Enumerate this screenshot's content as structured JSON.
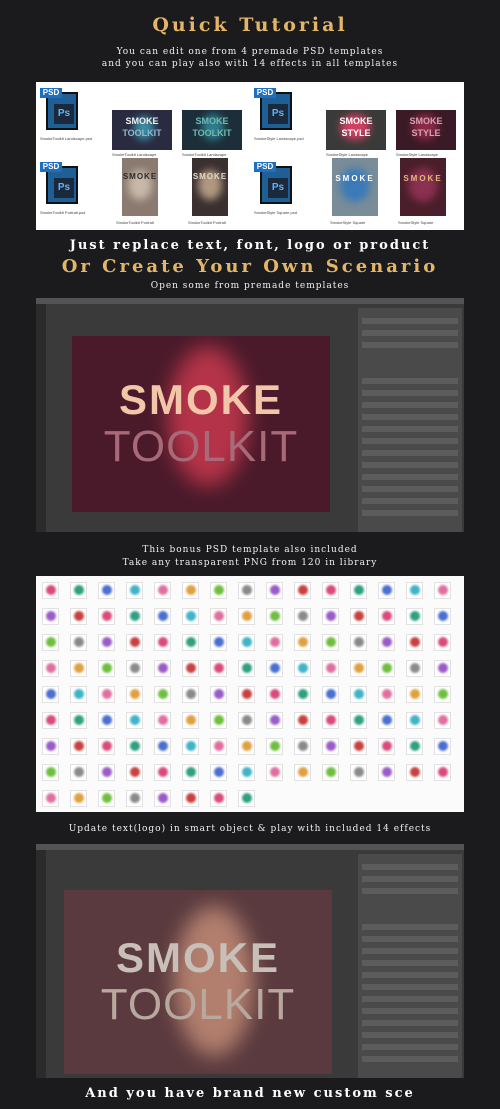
{
  "header": {
    "title": "Quick Tutorial",
    "intro_line1": "You can edit one from 4 premade PSD templates",
    "intro_line2": "and you can play also with 14 effects in all templates"
  },
  "templates_panel": {
    "file_tag": "PSD",
    "ps_glyph": "Ps",
    "groups": [
      {
        "thumb_text_top": "SMOKE",
        "thumb_text_bottom": "TOOLKIT"
      },
      {
        "thumb_text_top": "SMOKE",
        "thumb_text_bottom": "STYLE"
      }
    ],
    "file_names": [
      "SmokeToolkit Landscape.psd",
      "SmokeToolkit Landscape",
      "SmokeToolkit Landscape",
      "SmokeStyle Landscape.psd",
      "SmokeStyle Landscape",
      "SmokeStyle Landscape",
      "SmokeToolkit Portrait.psd",
      "SmokeToolkit Portrait",
      "SmokeToolkit Portrait",
      "SmokeStyle Square.psd",
      "SmokeStyle Square",
      "SmokeStyle Square"
    ]
  },
  "section2": {
    "line1": "Just replace text, font, logo or product",
    "title": "Or Create Your Own Scenario",
    "subtitle": "Open some from premade templates"
  },
  "screenshot1": {
    "text_top": "SMOKE",
    "text_bottom": "TOOLKIT",
    "canvas_bg": "#4a1a2a",
    "text_top_color": "#f2c6a8",
    "text_bottom_color": "#a86a78"
  },
  "section3": {
    "line1": "This bonus PSD template also included",
    "line2": "Take any transparent PNG from 120 in library"
  },
  "library": {
    "colors": [
      "#d94a7a",
      "#3fb3c8",
      "#6fbf3f",
      "#c84040",
      "#4a6fd0",
      "#e0a040",
      "#9a5bc8",
      "#2fa080",
      "#e06fa0",
      "#8a8a8a"
    ]
  },
  "section4": {
    "line1": "Update text(logo) in smart object & play with included 14 effects"
  },
  "screenshot2": {
    "text_top": "SMOKE",
    "text_bottom": "TOOLKIT",
    "canvas_bg": "#5a3a3e",
    "text_top_color": "#c8c0b8",
    "text_bottom_color": "#b8a89e"
  },
  "footer": {
    "line1": "And you have brand new custom sce"
  }
}
